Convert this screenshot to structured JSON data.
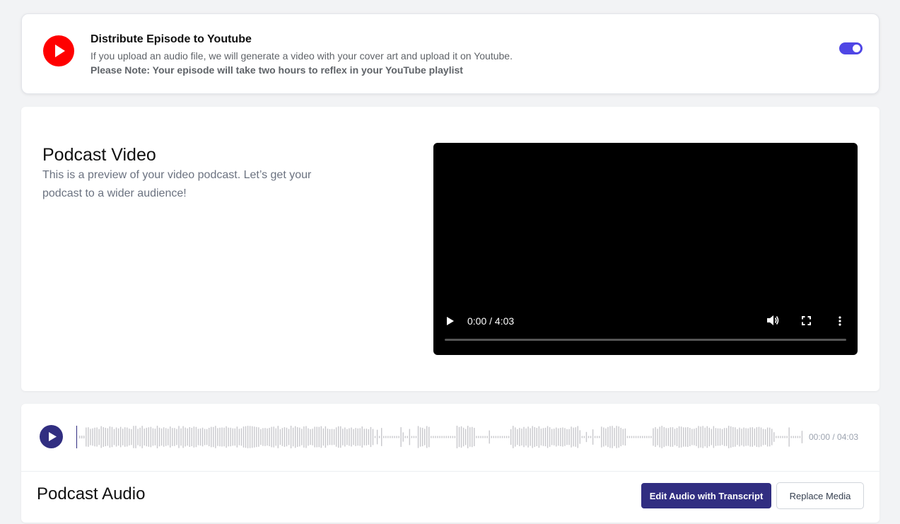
{
  "youtube": {
    "title": "Distribute Episode to Youtube",
    "description": "If you upload an audio file, we will generate a video with your cover art and upload it on Youtube.",
    "note": "Please Note: Your episode will take two hours to reflex in your YouTube playlist",
    "enabled": true,
    "logo_icon": "youtube-play-icon",
    "brand_color": "#ff0000",
    "toggle_color": "#4f46e5"
  },
  "video": {
    "title": "Podcast Video",
    "description": "This is a preview of your video podcast. Let’s get your podcast to a wider audience!",
    "player": {
      "time": "0:00 / 4:03",
      "progress": 0.0,
      "controls": [
        "play-icon",
        "volume-icon",
        "fullscreen-icon",
        "more-vert-icon"
      ]
    }
  },
  "audio": {
    "title": "Podcast Audio",
    "time": "00:00 / 04:03",
    "edit_button": "Edit Audio with Transcript",
    "replace_button": "Replace Media",
    "accent_color": "#312e81",
    "waveform_color": "#c8c8cc"
  }
}
